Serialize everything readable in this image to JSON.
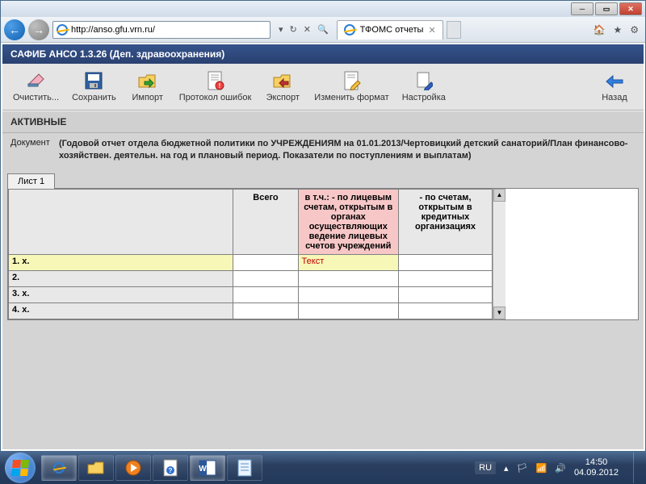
{
  "browser": {
    "url": "http://anso.gfu.vrn.ru/",
    "tab_title": "ТФОМС отчеты"
  },
  "app": {
    "title": "САФИБ АНСО 1.3.26 (Деп. здравоохранения)",
    "toolbar": {
      "clear": "Очистить...",
      "save": "Сохранить",
      "import": "Импорт",
      "errprot": "Протокол ошибок",
      "export": "Экспорт",
      "chfmt": "Изменить формат",
      "settings": "Настройка",
      "back": "Назад"
    },
    "section": "АКТИВНЫЕ",
    "doc_label": "Документ",
    "doc_text": "(Годовой отчет отдела бюджетной политики по УЧРЕЖДЕНИЯМ на 01.01.2013/Чертовицкий детский санаторий/План финансово-хозяйствен. деятельн. на год и плановый период. Показатели по поступлениям и выплатам)",
    "sheet_tab": "Лист 1",
    "columns": {
      "c0": "",
      "c1": "Всего",
      "c2": "в т.ч.: - по лицевым счетам, открытым в органах осуществляющих ведение лицевых счетов учреждений",
      "c3": "- по счетам, открытым в кредитных организациях"
    },
    "rows": {
      "r1": "1. x.",
      "r2": "2.",
      "r3": "3. x.",
      "r4": "4. x."
    },
    "active_cell_value": "Текст"
  },
  "system": {
    "lang": "RU",
    "time": "14:50",
    "date": "04.09.2012"
  }
}
